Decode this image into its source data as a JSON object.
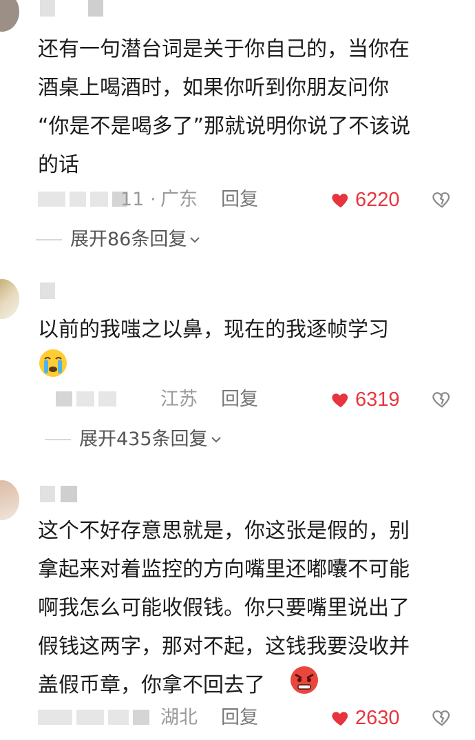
{
  "comments": [
    {
      "text": "还有一句潜台词是关于你自己的，当你在\n酒桌上喝酒时，如果你听到你朋友问你\n“你是不是喝多了”那就说明你说了不该说\n的话",
      "date_fragment": "11 ·",
      "location": "广东",
      "reply_label": "回复",
      "likes": "6220",
      "expand_label": "展开86条回复"
    },
    {
      "text": "以前的我嗤之以鼻，现在的我逐帧学习",
      "emoji": "crying-face",
      "location": "江苏",
      "reply_label": "回复",
      "likes": "6319",
      "expand_label": "展开435条回复"
    },
    {
      "text": "这个不好存意思就是，你这张是假的，别\n拿起来对着监控的方向嘴里还嘟囔不可能\n啊我怎么可能收假钱。你只要嘴里说出了\n假钱这两字，那对不起，这钱我要没收并\n盖假币章，你拿不回去了",
      "emoji": "angry-face",
      "location": "湖北",
      "reply_label": "回复",
      "likes": "2630"
    }
  ],
  "colors": {
    "like": "#e8343e",
    "meta": "#9a9a9a",
    "text": "#1c1c1c"
  }
}
